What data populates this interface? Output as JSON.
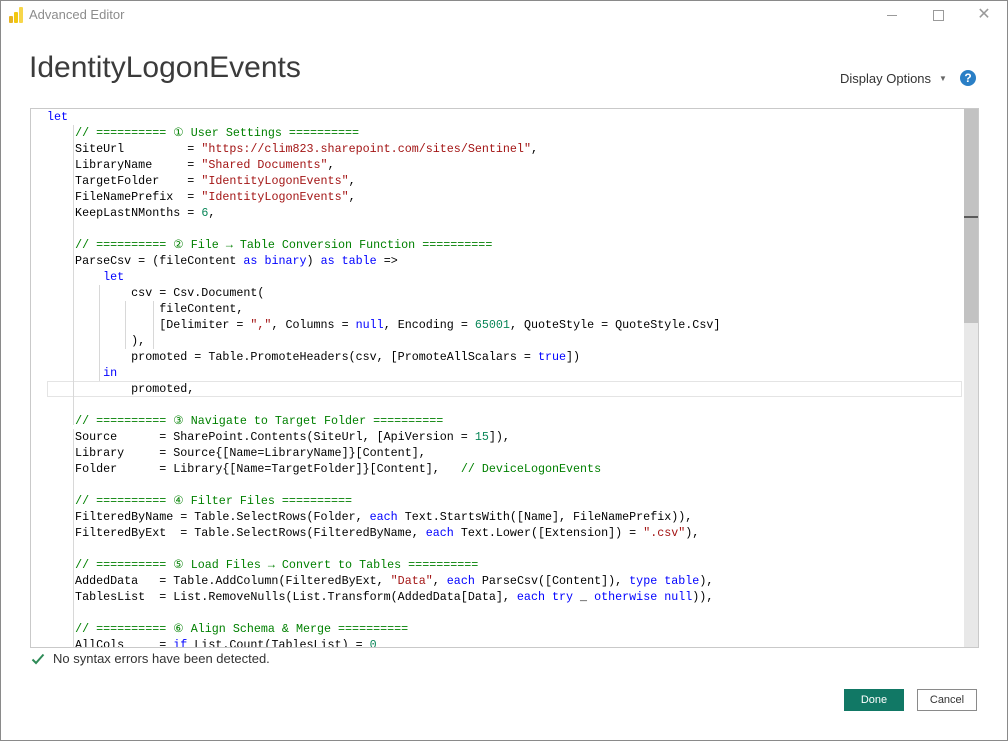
{
  "window": {
    "title": "Advanced Editor",
    "app_icon": "power-bi-icon"
  },
  "header": {
    "query_title": "IdentityLogonEvents",
    "display_options_label": "Display Options",
    "help_label": "?"
  },
  "editor": {
    "lines": [
      [
        {
          "t": "let",
          "c": "kw"
        }
      ],
      [
        {
          "t": "    "
        },
        {
          "t": "// ========== ① User Settings ==========",
          "c": "cm"
        }
      ],
      [
        {
          "t": "    SiteUrl         = "
        },
        {
          "t": "\"https://clim823.sharepoint.com/sites/Sentinel\"",
          "c": "str"
        },
        {
          "t": ","
        }
      ],
      [
        {
          "t": "    LibraryName     = "
        },
        {
          "t": "\"Shared Documents\"",
          "c": "str"
        },
        {
          "t": ","
        }
      ],
      [
        {
          "t": "    TargetFolder    = "
        },
        {
          "t": "\"IdentityLogonEvents\"",
          "c": "str"
        },
        {
          "t": ","
        }
      ],
      [
        {
          "t": "    FileNamePrefix  = "
        },
        {
          "t": "\"IdentityLogonEvents\"",
          "c": "str"
        },
        {
          "t": ","
        }
      ],
      [
        {
          "t": "    KeepLastNMonths = "
        },
        {
          "t": "6",
          "c": "num"
        },
        {
          "t": ","
        }
      ],
      [],
      [
        {
          "t": "    "
        },
        {
          "t": "// ========== ② File → Table Conversion Function ==========",
          "c": "cm"
        }
      ],
      [
        {
          "t": "    ParseCsv = (fileContent "
        },
        {
          "t": "as",
          "c": "kw"
        },
        {
          "t": " "
        },
        {
          "t": "binary",
          "c": "kw"
        },
        {
          "t": ") "
        },
        {
          "t": "as",
          "c": "kw"
        },
        {
          "t": " "
        },
        {
          "t": "table",
          "c": "kw"
        },
        {
          "t": " =>"
        }
      ],
      [
        {
          "t": "        "
        },
        {
          "t": "let",
          "c": "kw"
        }
      ],
      [
        {
          "t": "            csv = Csv.Document("
        }
      ],
      [
        {
          "t": "                fileContent,"
        }
      ],
      [
        {
          "t": "                [Delimiter = "
        },
        {
          "t": "\",\"",
          "c": "str"
        },
        {
          "t": ", Columns = "
        },
        {
          "t": "null",
          "c": "kw"
        },
        {
          "t": ", Encoding = "
        },
        {
          "t": "65001",
          "c": "num"
        },
        {
          "t": ", QuoteStyle = QuoteStyle.Csv]"
        }
      ],
      [
        {
          "t": "            ),"
        }
      ],
      [
        {
          "t": "            promoted = Table.PromoteHeaders(csv, [PromoteAllScalars = "
        },
        {
          "t": "true",
          "c": "kw"
        },
        {
          "t": "])"
        }
      ],
      [
        {
          "t": "        "
        },
        {
          "t": "in",
          "c": "kw"
        }
      ],
      [
        {
          "t": "            promoted,"
        }
      ],
      [],
      [
        {
          "t": "    "
        },
        {
          "t": "// ========== ③ Navigate to Target Folder ==========",
          "c": "cm"
        }
      ],
      [
        {
          "t": "    Source      = SharePoint.Contents(SiteUrl, [ApiVersion = "
        },
        {
          "t": "15",
          "c": "num"
        },
        {
          "t": "]),"
        }
      ],
      [
        {
          "t": "    Library     = Source{[Name=LibraryName]}[Content],"
        }
      ],
      [
        {
          "t": "    Folder      = Library{[Name=TargetFolder]}[Content],   "
        },
        {
          "t": "// DeviceLogonEvents",
          "c": "cm"
        }
      ],
      [],
      [
        {
          "t": "    "
        },
        {
          "t": "// ========== ④ Filter Files ==========",
          "c": "cm"
        }
      ],
      [
        {
          "t": "    FilteredByName = Table.SelectRows(Folder, "
        },
        {
          "t": "each",
          "c": "kw"
        },
        {
          "t": " Text.StartsWith([Name], FileNamePrefix)),"
        }
      ],
      [
        {
          "t": "    FilteredByExt  = Table.SelectRows(FilteredByName, "
        },
        {
          "t": "each",
          "c": "kw"
        },
        {
          "t": " Text.Lower([Extension]) = "
        },
        {
          "t": "\".csv\"",
          "c": "str"
        },
        {
          "t": "),"
        }
      ],
      [],
      [
        {
          "t": "    "
        },
        {
          "t": "// ========== ⑤ Load Files → Convert to Tables ==========",
          "c": "cm"
        }
      ],
      [
        {
          "t": "    AddedData   = Table.AddColumn(FilteredByExt, "
        },
        {
          "t": "\"Data\"",
          "c": "str"
        },
        {
          "t": ", "
        },
        {
          "t": "each",
          "c": "kw"
        },
        {
          "t": " ParseCsv([Content]), "
        },
        {
          "t": "type",
          "c": "kw"
        },
        {
          "t": " "
        },
        {
          "t": "table",
          "c": "kw"
        },
        {
          "t": "),"
        }
      ],
      [
        {
          "t": "    TablesList  = List.RemoveNulls(List.Transform(AddedData[Data], "
        },
        {
          "t": "each",
          "c": "kw"
        },
        {
          "t": " "
        },
        {
          "t": "try",
          "c": "kw"
        },
        {
          "t": " _ "
        },
        {
          "t": "otherwise",
          "c": "kw"
        },
        {
          "t": " "
        },
        {
          "t": "null",
          "c": "kw"
        },
        {
          "t": ")),"
        }
      ],
      [],
      [
        {
          "t": "    "
        },
        {
          "t": "// ========== ⑥ Align Schema & Merge ==========",
          "c": "cm"
        }
      ],
      [
        {
          "t": "    AllCols     = "
        },
        {
          "t": "if",
          "c": "kw"
        },
        {
          "t": " List.Count(TablesList) = "
        },
        {
          "t": "0",
          "c": "num"
        }
      ]
    ]
  },
  "status": {
    "message": "No syntax errors have been detected.",
    "icon": "checkmark-icon"
  },
  "buttons": {
    "done": "Done",
    "cancel": "Cancel"
  },
  "colors": {
    "primary_button": "#117865",
    "keyword": "#0000ff",
    "string": "#a31515",
    "number": "#098658",
    "comment": "#008000"
  }
}
